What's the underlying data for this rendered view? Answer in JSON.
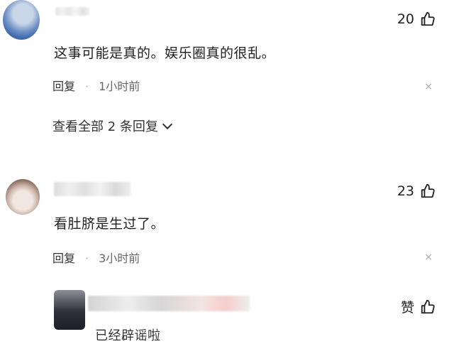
{
  "comments": [
    {
      "text": "这事可能是真的。娱乐圈真的很乱。",
      "likes": "20",
      "reply_label": "回复",
      "separator": "·",
      "time": "1小时前",
      "view_replies": "查看全部 2 条回复",
      "close": "×"
    },
    {
      "text": "看肚脐是生过了。",
      "likes": "23",
      "reply_label": "回复",
      "separator": "·",
      "time": "3小时前",
      "close": "×"
    },
    {
      "text": "已经辟谣啦",
      "likes": "赞"
    }
  ],
  "icons": {
    "like": "thumbs-up-icon",
    "collapse": "chevron-down-icon",
    "dismiss": "close-icon"
  }
}
